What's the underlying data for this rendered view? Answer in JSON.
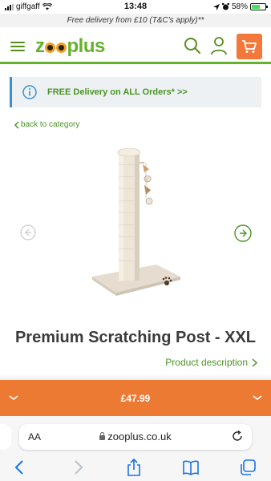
{
  "status_bar": {
    "carrier": "giffgaff",
    "time": "13:48",
    "battery": "58%"
  },
  "promo": {
    "text": "Free delivery from £10 (T&C's apply)**"
  },
  "header": {
    "logo": "zooplus",
    "brand_color": "#64b22a",
    "cart_color": "#f2793b",
    "icons": [
      "menu-icon",
      "search-icon",
      "account-icon",
      "cart-icon"
    ]
  },
  "delivery_banner": {
    "text": "FREE Delivery on ALL Orders* >>",
    "icon": "info-icon"
  },
  "nav": {
    "back_label": "back to category"
  },
  "product": {
    "title": "Premium Scratching Post - XXL",
    "description_link": "Product description"
  },
  "price_bar": {
    "price": "£47.99",
    "color": "#ec7a33"
  },
  "browser": {
    "aa_label": "AA",
    "url": "zooplus.co.uk",
    "toolbar_icons": [
      "back-icon",
      "forward-icon",
      "share-icon",
      "bookmarks-icon",
      "tabs-icon"
    ]
  }
}
